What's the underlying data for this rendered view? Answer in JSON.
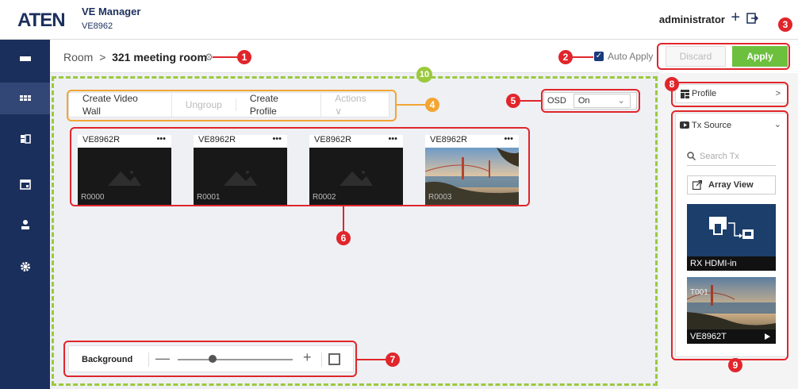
{
  "header": {
    "logo": "ATEN",
    "app_title": "VE Manager",
    "app_model": "VE8962",
    "user": "administrator"
  },
  "sidebar": {
    "items": [
      {
        "icon": "video-wall-icon"
      },
      {
        "icon": "room-icon",
        "active": true
      },
      {
        "icon": "layout-icon"
      },
      {
        "icon": "calendar-icon"
      },
      {
        "icon": "user-icon"
      },
      {
        "icon": "gear-icon"
      }
    ]
  },
  "breadcrumb": {
    "root": "Room",
    "sep": ">",
    "current": "321 meeting room"
  },
  "auto_apply": {
    "label": "Auto Apply",
    "checked": true
  },
  "actions": {
    "discard": "Discard",
    "apply": "Apply"
  },
  "toolbar": {
    "items": [
      "Create Video Wall",
      "Ungroup",
      "Create Profile",
      "Actions ∨"
    ]
  },
  "osd": {
    "label": "OSD",
    "value": "On"
  },
  "receivers": [
    {
      "model": "VE8962R",
      "id": "R0000"
    },
    {
      "model": "VE8962R",
      "id": "R0001"
    },
    {
      "model": "VE8962R",
      "id": "R0002"
    },
    {
      "model": "VE8962R",
      "id": "R0003"
    }
  ],
  "background": {
    "label": "Background",
    "level": 0.3
  },
  "right_panel": {
    "profile": "Profile",
    "tx_source": "Tx Source",
    "search_placeholder": "Search Tx",
    "array_view": "Array View",
    "sources": [
      {
        "label": "RX HDMI-in"
      },
      {
        "label": "VE8962T",
        "id": "T001"
      }
    ]
  },
  "callouts": [
    "1",
    "2",
    "3",
    "4",
    "5",
    "6",
    "7",
    "8",
    "9",
    "10"
  ],
  "colors": {
    "brand": "#1b2f5c",
    "apply": "#6cc03e",
    "callout": "#e0262b",
    "accent": "#f3a534",
    "zone": "#9bc93c"
  }
}
